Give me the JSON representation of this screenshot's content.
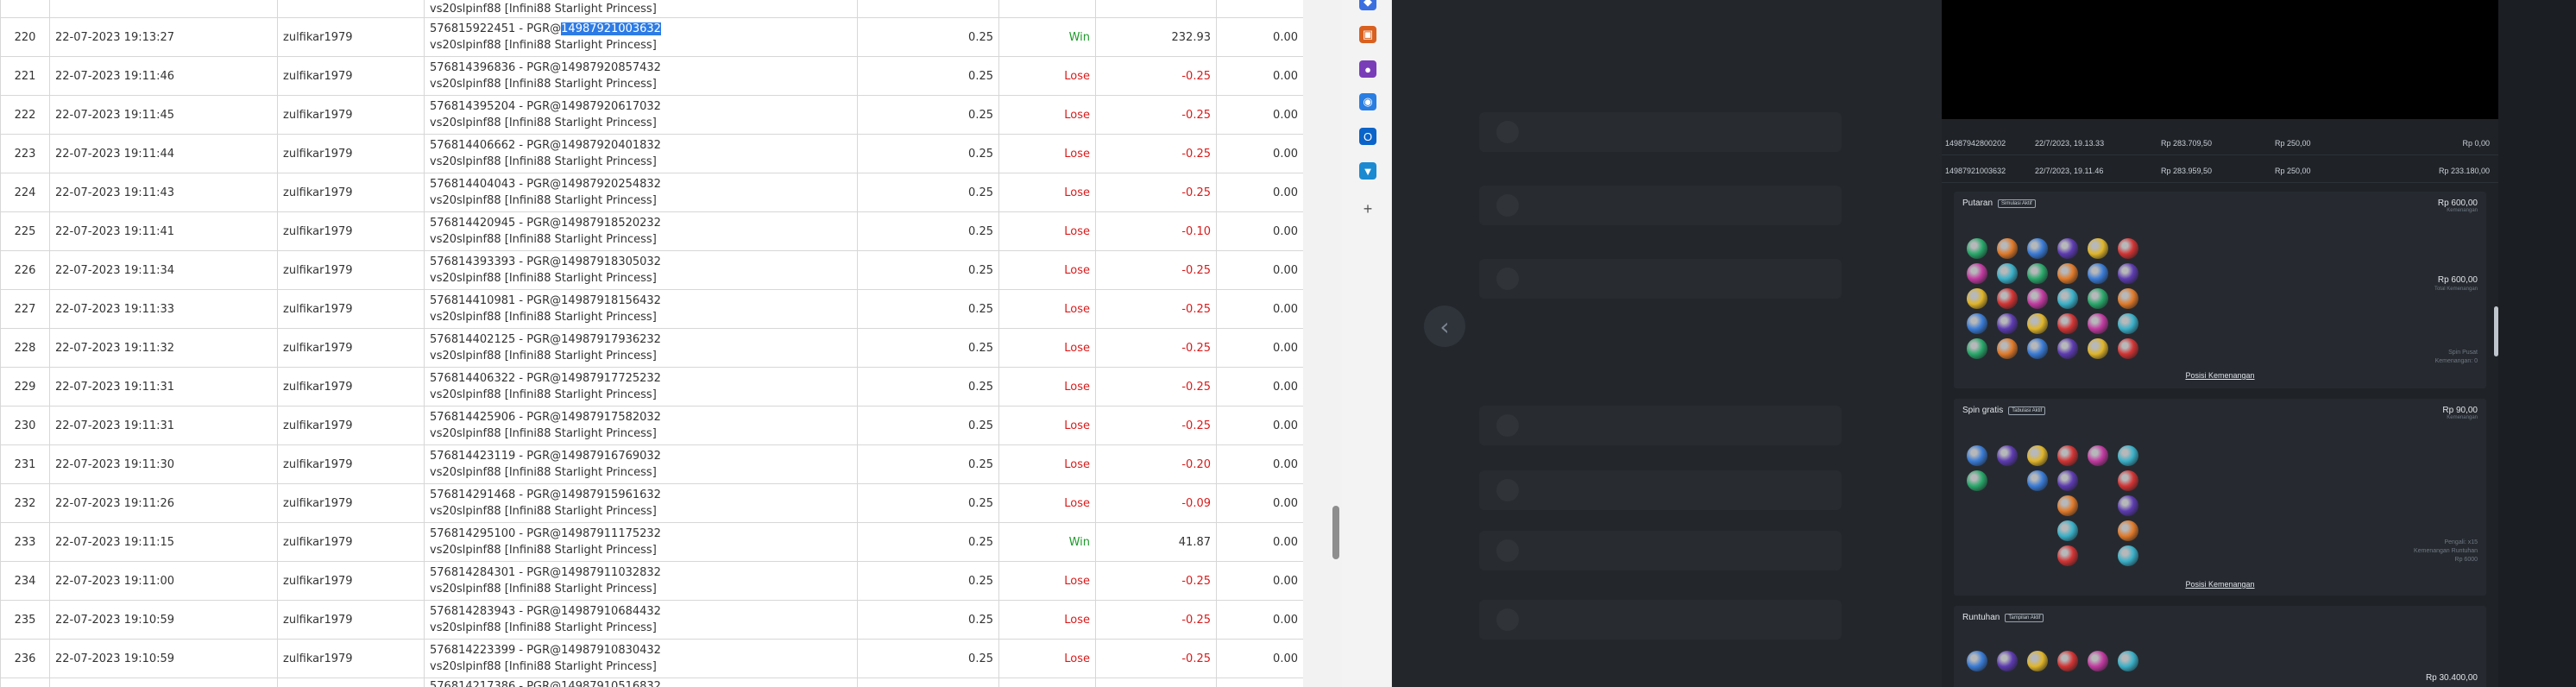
{
  "report": {
    "partial_top": {
      "no": "",
      "transaction": "vs20slpinf88 [Infini88 Starlight Princess]"
    },
    "rows": [
      {
        "no": "220",
        "datetime": "22-07-2023 19:13:27",
        "user": "zulfikar1979",
        "trans_pre": "576815922451 - PGR@",
        "trans_hl": "14987921003632",
        "game": "vs20slpinf88 [Infini88 Starlight Princess]",
        "bet": "0.25",
        "result": "Win",
        "win": "232.93",
        "jackpot": "0.00"
      },
      {
        "no": "221",
        "datetime": "22-07-2023 19:11:46",
        "user": "zulfikar1979",
        "trans_pre": "576814396836 - PGR@14987920857432",
        "trans_hl": "",
        "game": "vs20slpinf88 [Infini88 Starlight Princess]",
        "bet": "0.25",
        "result": "Lose",
        "win": "-0.25",
        "jackpot": "0.00"
      },
      {
        "no": "222",
        "datetime": "22-07-2023 19:11:45",
        "user": "zulfikar1979",
        "trans_pre": "576814395204 - PGR@14987920617032",
        "trans_hl": "",
        "game": "vs20slpinf88 [Infini88 Starlight Princess]",
        "bet": "0.25",
        "result": "Lose",
        "win": "-0.25",
        "jackpot": "0.00"
      },
      {
        "no": "223",
        "datetime": "22-07-2023 19:11:44",
        "user": "zulfikar1979",
        "trans_pre": "576814406662 - PGR@14987920401832",
        "trans_hl": "",
        "game": "vs20slpinf88 [Infini88 Starlight Princess]",
        "bet": "0.25",
        "result": "Lose",
        "win": "-0.25",
        "jackpot": "0.00"
      },
      {
        "no": "224",
        "datetime": "22-07-2023 19:11:43",
        "user": "zulfikar1979",
        "trans_pre": "576814404043 - PGR@14987920254832",
        "trans_hl": "",
        "game": "vs20slpinf88 [Infini88 Starlight Princess]",
        "bet": "0.25",
        "result": "Lose",
        "win": "-0.25",
        "jackpot": "0.00"
      },
      {
        "no": "225",
        "datetime": "22-07-2023 19:11:41",
        "user": "zulfikar1979",
        "trans_pre": "576814420945 - PGR@14987918520232",
        "trans_hl": "",
        "game": "vs20slpinf88 [Infini88 Starlight Princess]",
        "bet": "0.25",
        "result": "Lose",
        "win": "-0.10",
        "jackpot": "0.00"
      },
      {
        "no": "226",
        "datetime": "22-07-2023 19:11:34",
        "user": "zulfikar1979",
        "trans_pre": "576814393393 - PGR@14987918305032",
        "trans_hl": "",
        "game": "vs20slpinf88 [Infini88 Starlight Princess]",
        "bet": "0.25",
        "result": "Lose",
        "win": "-0.25",
        "jackpot": "0.00"
      },
      {
        "no": "227",
        "datetime": "22-07-2023 19:11:33",
        "user": "zulfikar1979",
        "trans_pre": "576814410981 - PGR@14987918156432",
        "trans_hl": "",
        "game": "vs20slpinf88 [Infini88 Starlight Princess]",
        "bet": "0.25",
        "result": "Lose",
        "win": "-0.25",
        "jackpot": "0.00"
      },
      {
        "no": "228",
        "datetime": "22-07-2023 19:11:32",
        "user": "zulfikar1979",
        "trans_pre": "576814402125 - PGR@14987917936232",
        "trans_hl": "",
        "game": "vs20slpinf88 [Infini88 Starlight Princess]",
        "bet": "0.25",
        "result": "Lose",
        "win": "-0.25",
        "jackpot": "0.00"
      },
      {
        "no": "229",
        "datetime": "22-07-2023 19:11:31",
        "user": "zulfikar1979",
        "trans_pre": "576814406322 - PGR@14987917725232",
        "trans_hl": "",
        "game": "vs20slpinf88 [Infini88 Starlight Princess]",
        "bet": "0.25",
        "result": "Lose",
        "win": "-0.25",
        "jackpot": "0.00"
      },
      {
        "no": "230",
        "datetime": "22-07-2023 19:11:31",
        "user": "zulfikar1979",
        "trans_pre": "576814425906 - PGR@14987917582032",
        "trans_hl": "",
        "game": "vs20slpinf88 [Infini88 Starlight Princess]",
        "bet": "0.25",
        "result": "Lose",
        "win": "-0.25",
        "jackpot": "0.00"
      },
      {
        "no": "231",
        "datetime": "22-07-2023 19:11:30",
        "user": "zulfikar1979",
        "trans_pre": "576814423119 - PGR@14987916769032",
        "trans_hl": "",
        "game": "vs20slpinf88 [Infini88 Starlight Princess]",
        "bet": "0.25",
        "result": "Lose",
        "win": "-0.20",
        "jackpot": "0.00"
      },
      {
        "no": "232",
        "datetime": "22-07-2023 19:11:26",
        "user": "zulfikar1979",
        "trans_pre": "576814291468 - PGR@14987915961632",
        "trans_hl": "",
        "game": "vs20slpinf88 [Infini88 Starlight Princess]",
        "bet": "0.25",
        "result": "Lose",
        "win": "-0.09",
        "jackpot": "0.00"
      },
      {
        "no": "233",
        "datetime": "22-07-2023 19:11:15",
        "user": "zulfikar1979",
        "trans_pre": "576814295100 - PGR@14987911175232",
        "trans_hl": "",
        "game": "vs20slpinf88 [Infini88 Starlight Princess]",
        "bet": "0.25",
        "result": "Win",
        "win": "41.87",
        "jackpot": "0.00"
      },
      {
        "no": "234",
        "datetime": "22-07-2023 19:11:00",
        "user": "zulfikar1979",
        "trans_pre": "576814284301 - PGR@14987911032832",
        "trans_hl": "",
        "game": "vs20slpinf88 [Infini88 Starlight Princess]",
        "bet": "0.25",
        "result": "Lose",
        "win": "-0.25",
        "jackpot": "0.00"
      },
      {
        "no": "235",
        "datetime": "22-07-2023 19:10:59",
        "user": "zulfikar1979",
        "trans_pre": "576814283943 - PGR@14987910684432",
        "trans_hl": "",
        "game": "vs20slpinf88 [Infini88 Starlight Princess]",
        "bet": "0.25",
        "result": "Lose",
        "win": "-0.25",
        "jackpot": "0.00"
      },
      {
        "no": "236",
        "datetime": "22-07-2023 19:10:59",
        "user": "zulfikar1979",
        "trans_pre": "576814223399 - PGR@14987910830432",
        "trans_hl": "",
        "game": "vs20slpinf88 [Infini88 Starlight Princess]",
        "bet": "0.25",
        "result": "Lose",
        "win": "-0.25",
        "jackpot": "0.00"
      }
    ],
    "partial_bottom": {
      "transaction": "576814217386 - PGR@14987910516832"
    }
  },
  "sidebar": {
    "icons": [
      {
        "name": "diamond-icon",
        "color": "#3b6fe0"
      },
      {
        "name": "toolbox-icon",
        "color": "#d9601f"
      },
      {
        "name": "people-icon",
        "color": "#7a3db8"
      },
      {
        "name": "copilot-icon",
        "color": "#2a7de1"
      },
      {
        "name": "outlook-icon",
        "color": "#0a64c9"
      },
      {
        "name": "shopping-icon",
        "color": "#1b8ad1"
      },
      {
        "name": "add-icon",
        "color": "#555555"
      }
    ]
  },
  "game": {
    "history_rows": [
      {
        "id": "14987942800202",
        "date": "22/7/2023, 19.13.33",
        "balance": "Rp 283.709,50",
        "bet": "Rp 250,00",
        "win": "Rp 0,00"
      },
      {
        "id": "14987921003632",
        "date": "22/7/2023, 19.11.46",
        "balance": "Rp 283.959,50",
        "bet": "Rp 250,00",
        "win": "Rp 233.180,00"
      }
    ],
    "sections": [
      {
        "title": "Putaran",
        "tag": "Simulasi Aktif",
        "amount": "Rp 600,00",
        "amount_sub": "Kemenangan",
        "mid_amount": "Rp 600,00",
        "mid_sub": "Total Kemenangan",
        "note_lines": [
          "Spin Pusat",
          "Kemenangan: 0"
        ],
        "link": "Posisi Kemenangan"
      },
      {
        "title": "Spin gratis",
        "tag": "Tabulasi Aktif",
        "amount": "Rp 90,00",
        "amount_sub": "Kemenangan",
        "note_lines": [
          "Pengali: x15",
          "",
          "Kemenangan Runtuhan",
          "Rp 6000"
        ],
        "link": "Posisi Kemenangan"
      },
      {
        "title": "Runtuhan",
        "tag": "Tampilan Aktif",
        "amount": "Rp 30.400,00"
      }
    ],
    "back_glyph": "‹"
  },
  "colors": {
    "win": "#1e9a2b",
    "lose": "#d81b1b",
    "highlight": "#2d7be5",
    "game_bg": "#23272c"
  }
}
